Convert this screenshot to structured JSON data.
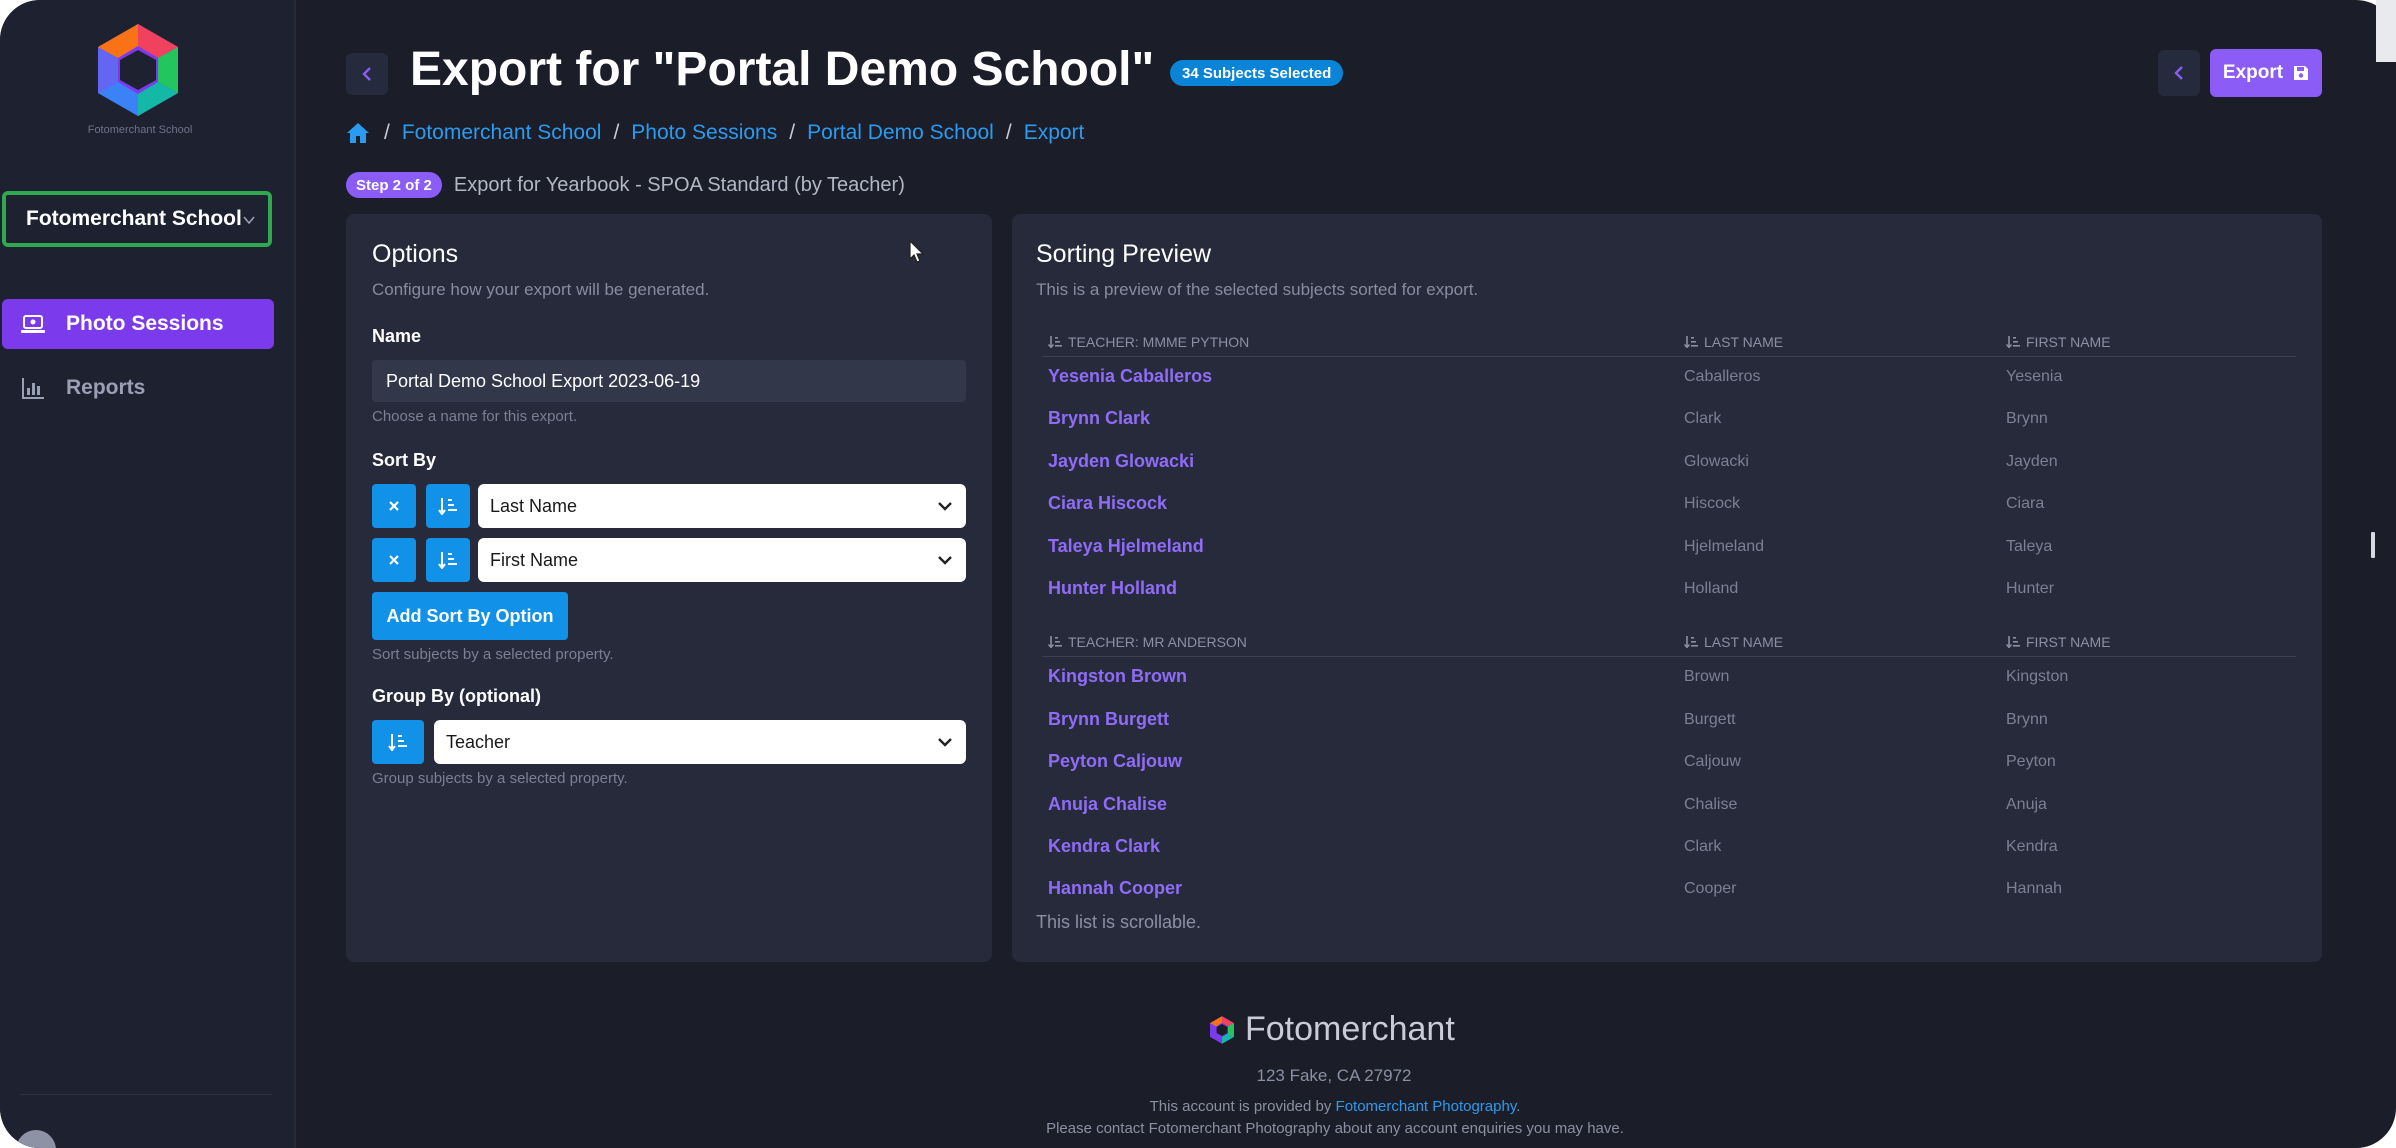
{
  "sidebar": {
    "logo_text": "Fotomerchant School",
    "school_select": "Fotomerchant School",
    "nav": [
      {
        "label": "Photo Sessions",
        "icon": "laptop-icon",
        "active": true
      },
      {
        "label": "Reports",
        "icon": "bar-chart-icon",
        "active": false
      }
    ]
  },
  "header": {
    "title": "Export for \"Portal Demo School\"",
    "subjects_badge": "34 Subjects Selected",
    "export_label": "Export",
    "breadcrumb": [
      "Fotomerchant School",
      "Photo Sessions",
      "Portal Demo School",
      "Export"
    ],
    "step_badge": "Step 2 of 2",
    "step_text": "Export for Yearbook - SPOA Standard (by Teacher)"
  },
  "options": {
    "title": "Options",
    "subtitle": "Configure how your export will be generated.",
    "name_label": "Name",
    "name_value": "Portal Demo School Export 2023-06-19",
    "name_help": "Choose a name for this export.",
    "sort_label": "Sort By",
    "sort_rows": [
      "Last Name",
      "First Name"
    ],
    "add_sort_label": "Add Sort By Option",
    "sort_help": "Sort subjects by a selected property.",
    "group_label": "Group By (optional)",
    "group_value": "Teacher",
    "group_help": "Group subjects by a selected property."
  },
  "preview": {
    "title": "Sorting Preview",
    "subtitle": "This is a preview of the selected subjects sorted for export.",
    "col_last": "LAST NAME",
    "col_first": "FIRST NAME",
    "groups": [
      {
        "heading": "TEACHER: MMME PYTHON",
        "rows": [
          {
            "full": "Yesenia Caballeros",
            "last": "Caballeros",
            "first": "Yesenia"
          },
          {
            "full": "Brynn Clark",
            "last": "Clark",
            "first": "Brynn"
          },
          {
            "full": "Jayden Glowacki",
            "last": "Glowacki",
            "first": "Jayden"
          },
          {
            "full": "Ciara Hiscock",
            "last": "Hiscock",
            "first": "Ciara"
          },
          {
            "full": "Taleya Hjelmeland",
            "last": "Hjelmeland",
            "first": "Taleya"
          },
          {
            "full": "Hunter Holland",
            "last": "Holland",
            "first": "Hunter"
          }
        ]
      },
      {
        "heading": "TEACHER: MR ANDERSON",
        "rows": [
          {
            "full": "Kingston Brown",
            "last": "Brown",
            "first": "Kingston"
          },
          {
            "full": "Brynn Burgett",
            "last": "Burgett",
            "first": "Brynn"
          },
          {
            "full": "Peyton Caljouw",
            "last": "Caljouw",
            "first": "Peyton"
          },
          {
            "full": "Anuja Chalise",
            "last": "Chalise",
            "first": "Anuja"
          },
          {
            "full": "Kendra Clark",
            "last": "Clark",
            "first": "Kendra"
          },
          {
            "full": "Hannah Cooper",
            "last": "Cooper",
            "first": "Hannah"
          }
        ]
      }
    ],
    "scroll_note": "This list is scrollable."
  },
  "footer": {
    "brand": "Fotomerchant",
    "address": "123 Fake, CA 27972",
    "line1_prefix": "This account is provided by ",
    "line1_link": "Fotomerchant Photography",
    "line1_suffix": ".",
    "line2": "Please contact Fotomerchant Photography about any account enquiries you may have."
  },
  "colors": {
    "accent_purple": "#8b5cf6",
    "accent_blue": "#1192e8",
    "link_blue": "#2b9bf0",
    "school_border": "#2fa84f",
    "background": "#1b1d29",
    "panel": "#262a3a"
  }
}
